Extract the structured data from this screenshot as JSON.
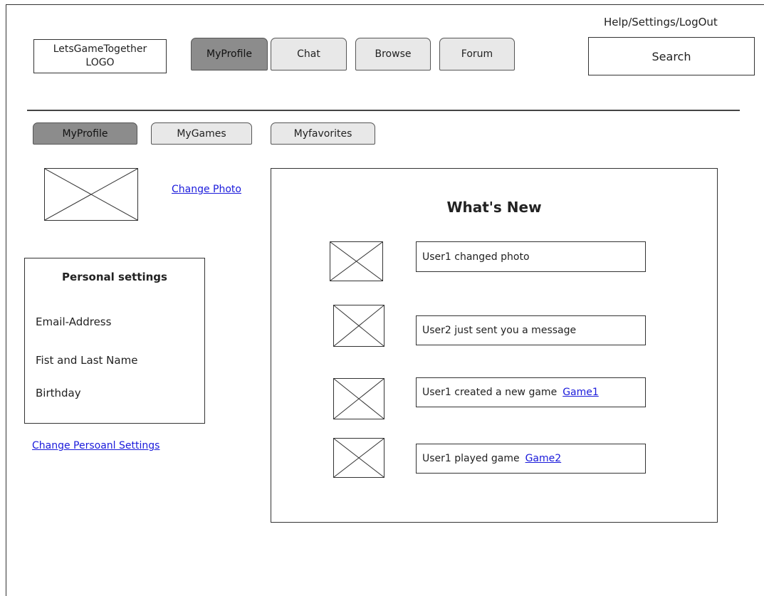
{
  "header": {
    "logo_line1": "LetsGameTogether",
    "logo_line2": "LOGO",
    "help_links": "Help/Settings/LogOut",
    "search_label": "Search"
  },
  "main_tabs": [
    {
      "label": "MyProfile",
      "active": true
    },
    {
      "label": "Chat",
      "active": false
    },
    {
      "label": "Browse",
      "active": false
    },
    {
      "label": "Forum",
      "active": false
    }
  ],
  "sub_tabs": [
    {
      "label": "MyProfile",
      "active": true
    },
    {
      "label": "MyGames",
      "active": false
    },
    {
      "label": "Myfavorites",
      "active": false
    }
  ],
  "profile": {
    "change_photo": "Change Photo",
    "change_settings": "Change Persoanl Settings"
  },
  "personal_settings": {
    "title": "Personal settings",
    "fields": [
      "Email-Address",
      "Fist and Last Name",
      "Birthday"
    ]
  },
  "whats_new": {
    "title": "What's New",
    "items": [
      {
        "text": "User1 changed photo",
        "link": ""
      },
      {
        "text": "User2 just sent you a message",
        "link": ""
      },
      {
        "text": "User1 created a new game",
        "link": "Game1"
      },
      {
        "text": "User1 played game",
        "link": "Game2"
      }
    ]
  },
  "colors": {
    "active_tab": "#8c8c8c",
    "inactive_tab": "#e8e8e8",
    "link": "#1a1adb"
  }
}
